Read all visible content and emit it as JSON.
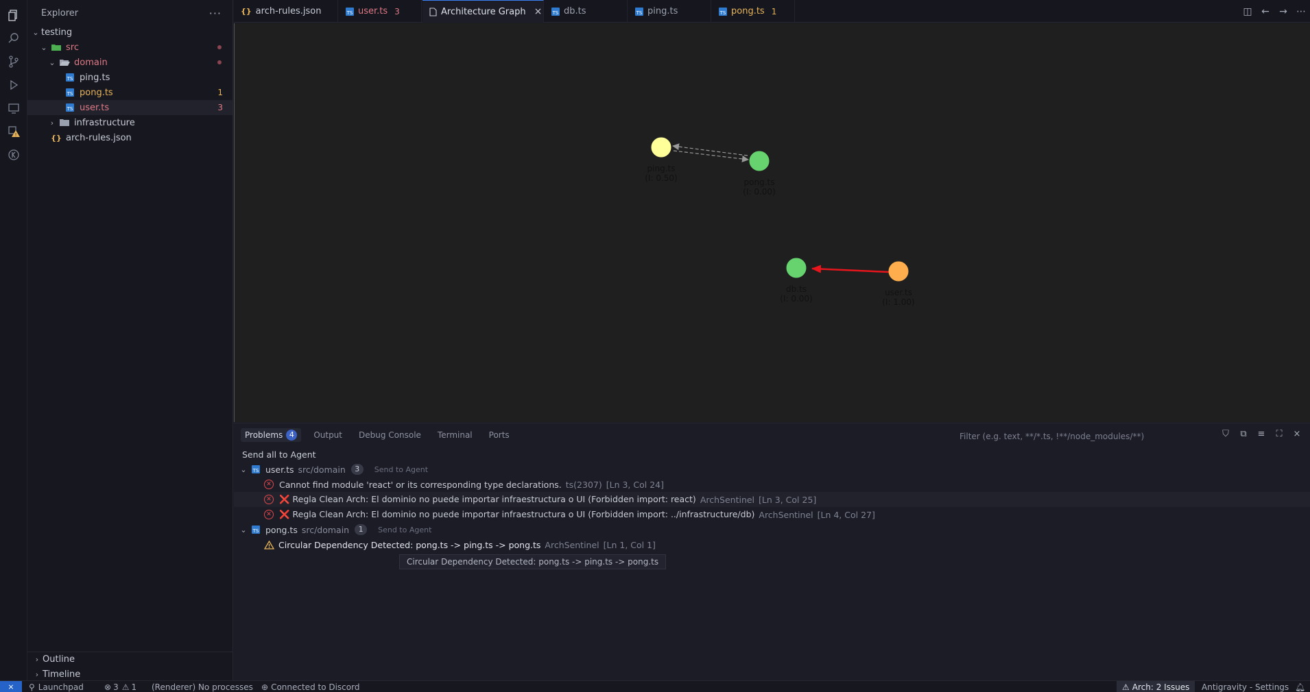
{
  "explorer": {
    "title": "Explorer",
    "more": "···",
    "tree": [
      {
        "label": "testing",
        "color": "#c9ccd6"
      },
      {
        "label": "src",
        "color": "#e07a85"
      },
      {
        "label": "domain",
        "color": "#e07a85"
      },
      {
        "label": "ping.ts",
        "color": "#c9ccd6"
      },
      {
        "label": "pong.ts",
        "color": "#e8b45a",
        "badge": "1"
      },
      {
        "label": "user.ts",
        "color": "#e07a85",
        "badge": "3"
      },
      {
        "label": "infrastructure",
        "color": "#c9ccd6"
      },
      {
        "label": "arch-rules.json",
        "color": "#c9ccd6"
      }
    ],
    "outline": "Outline",
    "timeline": "Timeline"
  },
  "tabs": [
    {
      "label": "arch-rules.json",
      "color": "#c9ccd6"
    },
    {
      "label": "user.ts",
      "color": "#e07a85",
      "badge": "3"
    },
    {
      "label": "Architecture Graph",
      "color": "#e0e3ec",
      "close": "×"
    },
    {
      "label": "db.ts",
      "color": "#9da1ae"
    },
    {
      "label": "ping.ts",
      "color": "#9da1ae"
    },
    {
      "label": "pong.ts",
      "color": "#e8b45a",
      "badge": "1"
    }
  ],
  "graph": {
    "nodes": [
      {
        "name": "ping.ts",
        "metric": "(I: 0.50)",
        "color": "#ffff99"
      },
      {
        "name": "pong.ts",
        "metric": "(I: 0.00)",
        "color": "#66d36e"
      },
      {
        "name": "db.ts",
        "metric": "(I: 0.00)",
        "color": "#66d36e"
      },
      {
        "name": "user.ts",
        "metric": "(I: 1.00)",
        "color": "#ffad4d"
      }
    ],
    "edge_colors": {
      "dashed": "#9a9a9a",
      "violation": "#e8161c"
    }
  },
  "panel": {
    "tabs": [
      {
        "label": "Problems",
        "badge": "4"
      },
      {
        "label": "Output"
      },
      {
        "label": "Debug Console"
      },
      {
        "label": "Terminal"
      },
      {
        "label": "Ports"
      }
    ],
    "filter_placeholder": "Filter (e.g. text, **/*.ts, !**/node_modules/**)",
    "send_all": "Send all to Agent",
    "groups": [
      {
        "file": "user.ts",
        "path": "src/domain",
        "count": "3",
        "send": "Send to Agent",
        "items": [
          {
            "message": "Cannot find module 'react' or its corresponding type declarations.",
            "source": "ts(2307)",
            "location": "[Ln 3, Col 24]"
          },
          {
            "message": "❌ Regla Clean Arch: El dominio no puede importar infraestructura o UI (Forbidden import: react)",
            "source": "ArchSentinel",
            "location": "[Ln 3, Col 25]"
          },
          {
            "message": "❌ Regla Clean Arch: El dominio no puede importar infraestructura o UI (Forbidden import: ../infrastructure/db)",
            "source": "ArchSentinel",
            "location": "[Ln 4, Col 27]"
          }
        ]
      },
      {
        "file": "pong.ts",
        "path": "src/domain",
        "count": "1",
        "send": "Send to Agent",
        "items": [
          {
            "message": "Circular Dependency Detected: pong.ts -> ping.ts -> pong.ts",
            "source": "ArchSentinel",
            "location": "[Ln 1, Col 1]"
          }
        ]
      }
    ],
    "tooltip": "Circular Dependency Detected: pong.ts -> ping.ts -> pong.ts"
  },
  "status": {
    "launchpad": "Launchpad",
    "errors": "3",
    "warnings": "1",
    "renderer": "(Renderer) No processes",
    "discord": "Connected to Discord",
    "arch": "Arch: 2 Issues",
    "settings": "Antigravity - Settings"
  },
  "colors": {
    "accent": "#3b82f6",
    "error": "#e5484d",
    "warning": "#e8b45a"
  }
}
